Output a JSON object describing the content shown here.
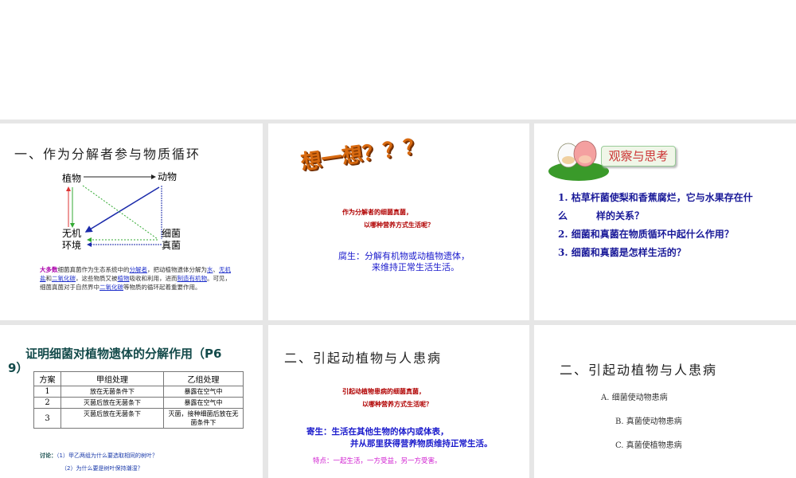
{
  "slides": [
    {
      "title": "一、作为分解者参与物质循环",
      "nodes": {
        "plant": "植物",
        "animal": "动物",
        "env1": "无机",
        "env2": "环境",
        "fungi1": "细菌",
        "fungi2": "真菌"
      },
      "para": {
        "lead": "大多数",
        "p1": "细菌真菌作为生态系统中的",
        "a1": "分解者",
        "p2": "，把动植物遗体分解为",
        "a2": "水",
        "p3": "、",
        "a3": "无机盐",
        "p4": "和",
        "a4": "二氧化碳",
        "p5": "，这些物质又被",
        "a5": "植物",
        "p6": "吸收和利用，进而",
        "a6": "制造有机物",
        "p7": "。可见，细菌真菌对于自然界中",
        "a7": "二氧化碳",
        "p8": "等物质的循环起着重要作用。"
      }
    },
    {
      "title": "想一想？？？",
      "q1": "作为分解者的细菌真菌，",
      "q2": "以哪种营养方式生活呢？",
      "a1": "腐生：分解有机物或动植物遗体，",
      "a2": "来维持正常生活生活。"
    },
    {
      "badge": "观察与思考",
      "items": [
        "1. 枯草杆菌使梨和香蕉腐烂，它与水果存在什",
        "么　　　样的关系？",
        "2. 细菌和真菌在物质循环中起什么作用？",
        "3. 细菌和真菌是怎样生活的？"
      ]
    },
    {
      "title": "证明细菌对植物遗体的分解作用（P6",
      "title2": "9）",
      "table": {
        "headers": [
          "方案",
          "甲组处理",
          "乙组处理"
        ],
        "rows": [
          [
            "1",
            "放在无菌条件下",
            "暴露在空气中"
          ],
          [
            "2",
            "灭菌后放在无菌条下",
            "暴露在空气中"
          ],
          [
            "3",
            "灭菌后放在无菌条下",
            "灭菌，接种细菌后放在无菌条件下"
          ]
        ]
      },
      "discuss_label": "讨论：",
      "d1": "（1）甲乙两组为什么要选取相同的树叶？",
      "d2": "（2）为什么要是树叶保持潮湿？"
    },
    {
      "title": "二、引起动植物与人患病",
      "q1": "引起动植物患病的细菌真菌，",
      "q2": "以哪种营养方式生活呢？",
      "a1": "寄生：生活在其他生物的体内或体表，",
      "a2": "并从那里获得营养物质维持正常生活。",
      "feature": "特点：一起生活，一方受益，另一方受害。"
    },
    {
      "title": "二、引起动植物与人患病",
      "items": [
        "A. 细菌使动物患病",
        "B. 真菌使动物患病",
        "C. 真菌使植物患病"
      ]
    }
  ]
}
